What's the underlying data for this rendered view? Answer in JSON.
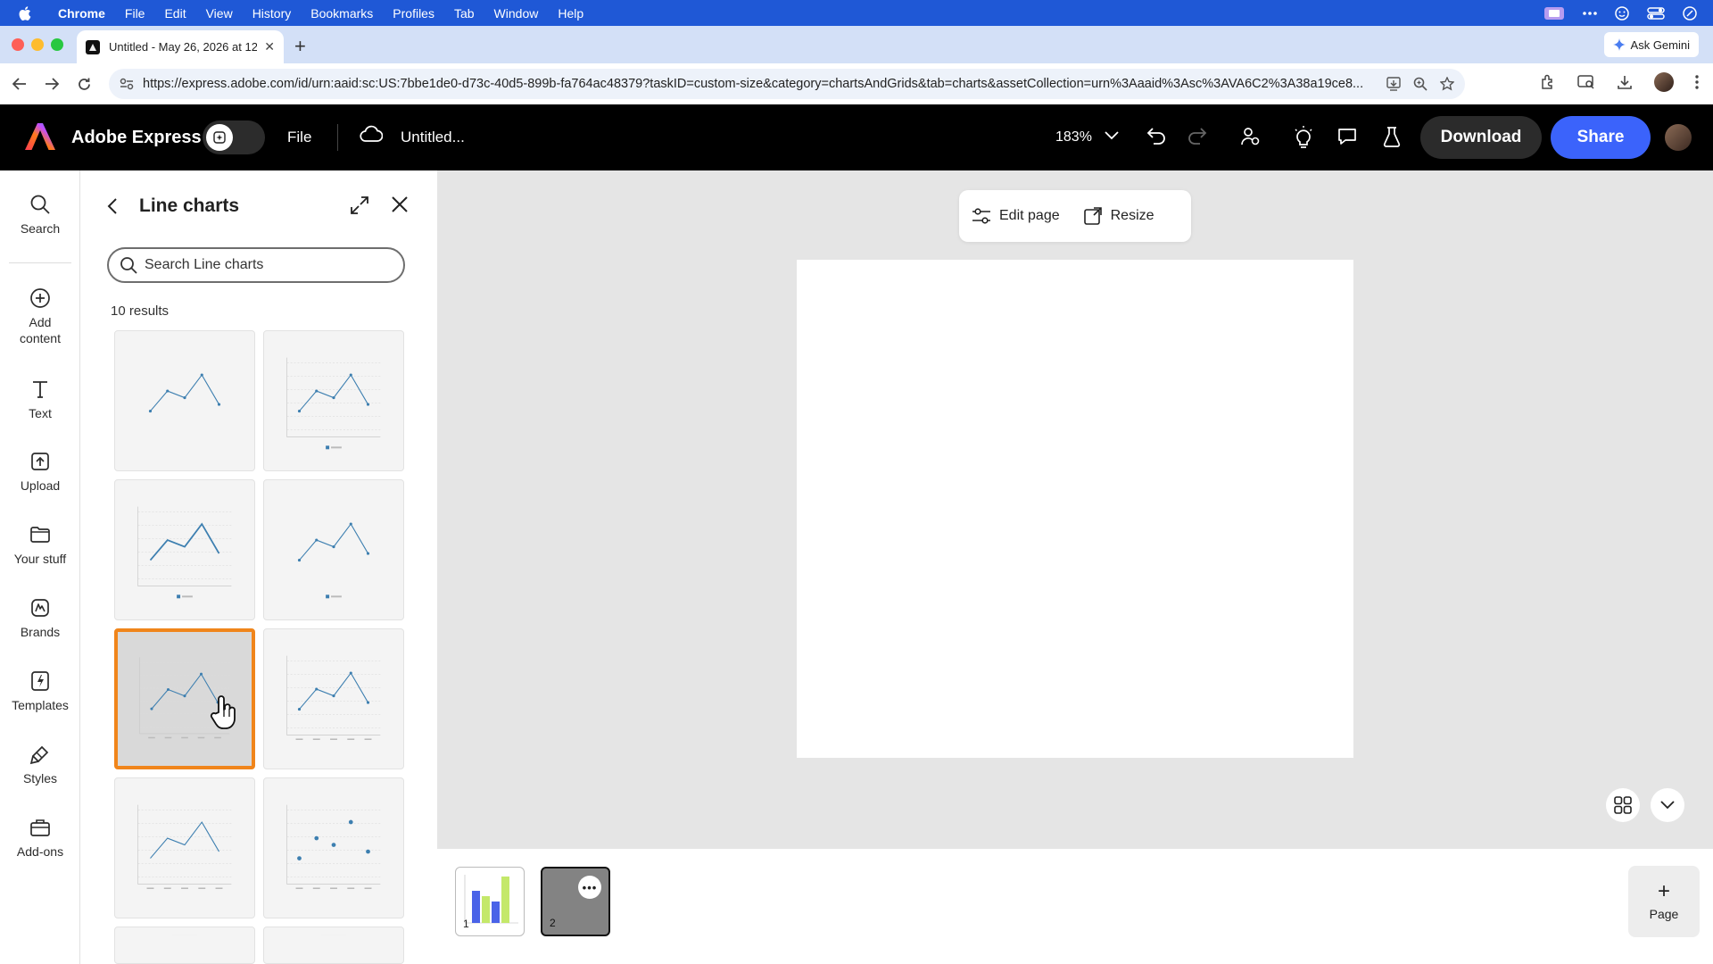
{
  "menubar": {
    "app": "Chrome",
    "items": [
      "File",
      "Edit",
      "View",
      "History",
      "Bookmarks",
      "Profiles",
      "Tab",
      "Window",
      "Help"
    ]
  },
  "browser": {
    "tab_title": "Untitled - May 26, 2026 at 12",
    "ask_gemini": "Ask Gemini",
    "url": "https://express.adobe.com/id/urn:aaid:sc:US:7bbe1de0-d73c-40d5-899b-fa764ac48379?taskID=custom-size&category=chartsAndGrids&tab=charts&assetCollection=urn%3Aaaid%3Asc%3AVA6C2%3A38a19ce8..."
  },
  "header": {
    "brand": "Adobe Express",
    "file": "File",
    "doc_title": "Untitled...",
    "zoom": "183%",
    "download": "Download",
    "share": "Share"
  },
  "rail": {
    "items": [
      {
        "label": "Search",
        "icon": "search-icon"
      },
      {
        "label": "Add content",
        "icon": "add-circle-icon"
      },
      {
        "label": "Text",
        "icon": "text-icon"
      },
      {
        "label": "Upload",
        "icon": "upload-icon"
      },
      {
        "label": "Your stuff",
        "icon": "folder-icon"
      },
      {
        "label": "Brands",
        "icon": "brand-icon"
      },
      {
        "label": "Templates",
        "icon": "templates-icon"
      },
      {
        "label": "Styles",
        "icon": "styles-icon"
      },
      {
        "label": "Add-ons",
        "icon": "addons-icon"
      }
    ]
  },
  "panel": {
    "title": "Line charts",
    "search_placeholder": "Search Line charts",
    "results": "10 results",
    "selected_index": 4
  },
  "canvas": {
    "edit_page": "Edit page",
    "resize": "Resize"
  },
  "pages": {
    "thumbs": [
      "1",
      "2"
    ],
    "add_page": "Page"
  },
  "colors": {
    "menubar": "#1f58d6",
    "share": "#3b63fb",
    "selection": "#f0851b",
    "chart_line": "#3d7fb0"
  }
}
